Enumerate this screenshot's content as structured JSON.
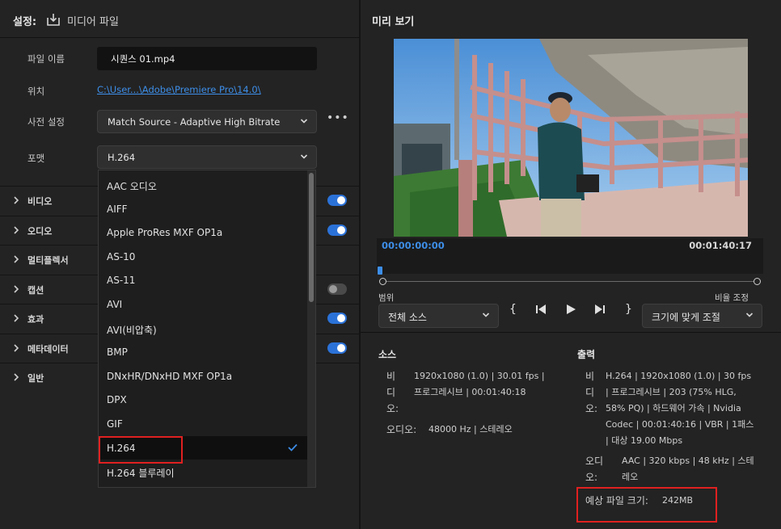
{
  "left": {
    "title": "설정:",
    "media_file": "미디어 파일",
    "fields": {
      "filename_label": "파일 이름",
      "filename_value": "시퀀스 01.mp4",
      "location_label": "위치",
      "location_value": "C:\\User...\\Adobe\\Premiere Pro\\14.0\\",
      "preset_label": "사전 설정",
      "preset_value": "Match Source - Adaptive High Bitrate",
      "format_label": "포맷",
      "format_value": "H.264"
    },
    "sections": [
      {
        "label": "비디오",
        "toggle": "on"
      },
      {
        "label": "오디오",
        "toggle": "on"
      },
      {
        "label": "멀티플렉서",
        "toggle": ""
      },
      {
        "label": "캡션",
        "toggle": "off"
      },
      {
        "label": "효과",
        "toggle": "on"
      },
      {
        "label": "메타데이터",
        "toggle": "on"
      },
      {
        "label": "일반",
        "toggle": ""
      }
    ],
    "format_options": [
      "AAC 오디오",
      "AIFF",
      "Apple ProRes MXF OP1a",
      "AS-10",
      "AS-11",
      "AVI",
      "AVI(비압축)",
      "BMP",
      "DNxHR/DNxHD MXF OP1a",
      "DPX",
      "GIF",
      "H.264",
      "H.264 블루레이"
    ],
    "selected_format_index": 11
  },
  "preview": {
    "title": "미리 보기",
    "timecode_start": "00:00:00:00",
    "timecode_end": "00:01:40:17",
    "playhead_fraction": 0.0,
    "range_label": "범위",
    "range_value": "전체 소스",
    "scale_label": "비율 조정",
    "scale_value": "크기에 맞게 조절",
    "controls": {
      "mark_in": "{",
      "mark_out": "}"
    }
  },
  "source": {
    "title": "소스",
    "video_key": "비디오:",
    "video_value": "1920x1080 (1.0) | 30.01 fps | 프로그레시브 | 00:01:40:18",
    "audio_key": "오디오:",
    "audio_value": "48000 Hz | 스테레오"
  },
  "output": {
    "title": "출력",
    "video_key": "비디오:",
    "video_value": "H.264 | 1920x1080 (1.0) | 30 fps | 프로그레시브 | 203 (75% HLG, 58% PQ) | 하드웨어 가속 | Nvidia Codec | 00:01:40:16 | VBR | 1패스 | 대상 19.00 Mbps",
    "audio_key": "오디오:",
    "audio_value": "AAC | 320 kbps | 48 kHz | 스테레오",
    "filesize_label": "예상 파일 크기:",
    "filesize_value": "242MB"
  },
  "colors": {
    "accent": "#2b72d8",
    "link": "#3d8ee8",
    "highlight": "#e02020"
  }
}
